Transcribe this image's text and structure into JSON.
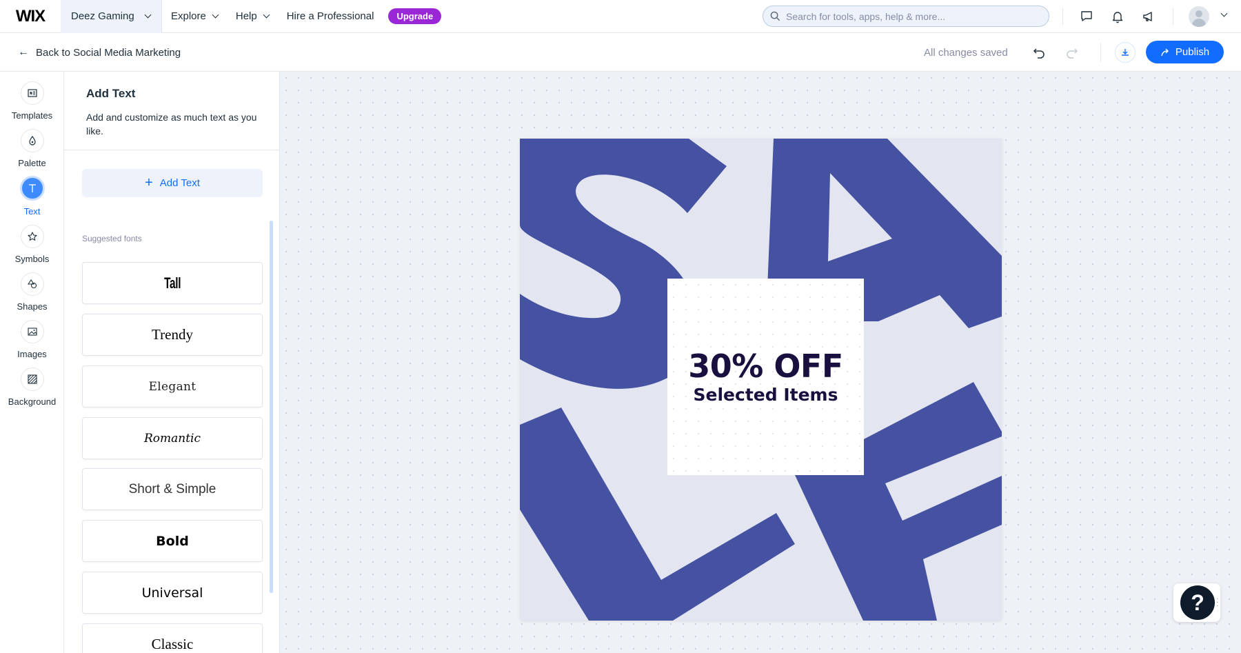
{
  "topbar": {
    "logo": "WIX",
    "site_name": "Deez Gaming",
    "nav": [
      "Explore",
      "Help"
    ],
    "hire": "Hire a Professional",
    "upgrade": "Upgrade",
    "search_placeholder": "Search for tools, apps, help & more...",
    "icons": [
      "chat-icon",
      "bell-icon",
      "megaphone-icon",
      "avatar"
    ]
  },
  "subbar": {
    "back_label": "Back to Social Media Marketing",
    "saved_status": "All changes saved",
    "publish_label": "Publish"
  },
  "rail": {
    "items": [
      {
        "label": "Templates",
        "icon": "templates-icon"
      },
      {
        "label": "Palette",
        "icon": "palette-icon"
      },
      {
        "label": "Text",
        "icon": "text-icon",
        "active": true
      },
      {
        "label": "Symbols",
        "icon": "star-icon"
      },
      {
        "label": "Shapes",
        "icon": "shapes-icon"
      },
      {
        "label": "Images",
        "icon": "image-icon"
      },
      {
        "label": "Background",
        "icon": "background-icon"
      }
    ]
  },
  "panel": {
    "title": "Add Text",
    "description": "Add and customize as much text as you like.",
    "add_text_label": "Add Text",
    "suggested_label": "Suggested fonts",
    "fonts": [
      "Tall",
      "Trendy",
      "Elegant",
      "Romantic",
      "Short & Simple",
      "Bold",
      "Universal",
      "Classic"
    ]
  },
  "design": {
    "headline": "30% OFF",
    "subheadline": "Selected Items",
    "accent_color": "#4552a2",
    "background_color": "#e3e6f1"
  },
  "colors": {
    "primary": "#116dff",
    "upgrade": "#9a27d5"
  }
}
